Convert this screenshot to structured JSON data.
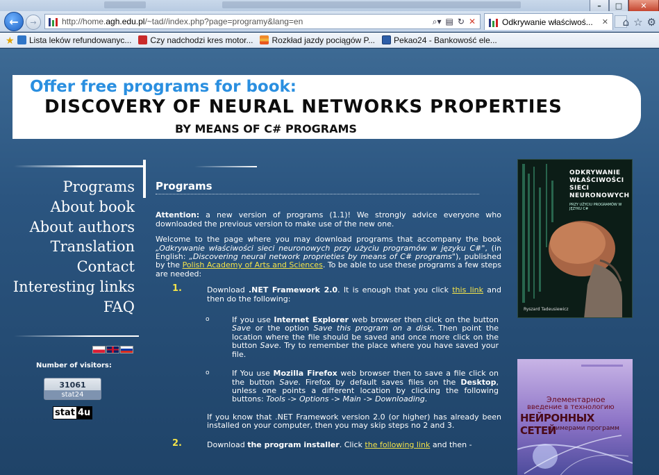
{
  "browser": {
    "address_prefix": "http://home.",
    "address_host": "agh.edu.pl",
    "address_path": "/~tad//index.php?page=programy&lang=en",
    "tab_title": "Odkrywanie właściwoś...",
    "favorites": [
      "Lista leków refundowanyc...",
      "Czy nadchodzi kres motor...",
      "Rozkład jazdy pociągów P...",
      "Pekao24 - Bankowość ele..."
    ]
  },
  "banner": {
    "offer": "Offer free programs for book:",
    "title": "DISCOVERY OF NEURAL NETWORKS PROPERTIES",
    "subtitle": "BY MEANS OF C# PROGRAMS"
  },
  "menu": {
    "items": [
      "Programs",
      "About book",
      "About authors",
      "Translation",
      "Contact",
      "Interesting links",
      "FAQ"
    ]
  },
  "sidebar": {
    "visitors_label": "Number of visitors:",
    "counter_value": "31061",
    "counter_brand": "stat24",
    "stat4u_a": "stat",
    "stat4u_b": "4u"
  },
  "content": {
    "heading": "Programs",
    "attention_label": "Attention:",
    "attention_text": " a new version of programs (1.1)! We strongly advice everyone who downloaded the previous version to make use of the new one.",
    "welcome_1": "Welcome to the page where you may download programs that accompany the book ",
    "welcome_title_pl": "„Odkrywanie właściwości sieci neuronowych przy użyciu programów w języku C#\"",
    "welcome_2": ", (in English: ",
    "welcome_title_en": "„Discovering neural network proprieties by means of C# programs\"",
    "welcome_3": "), published by the ",
    "welcome_link": "Polish Academy of Arts and Sciences",
    "welcome_4": ". To be able to use these programs a few steps are needed:",
    "step1_num": "1.",
    "step1_a": "Download ",
    "step1_bold": ".NET Framework 2.0",
    "step1_b": ". It is enough that you click ",
    "step1_link": "this link",
    "step1_c": " and then do the following:",
    "bullet": "o",
    "ie_a": "If you use ",
    "ie_bold": "Internet Explorer",
    "ie_b": " web browser then click on the button ",
    "ie_save": "Save",
    "ie_c": " or the option ",
    "ie_option": "Save this program on a disk",
    "ie_d": ". Then point the location where the file should be saved and once more click on the button ",
    "ie_save2": "Save",
    "ie_e": ". Try to remember the place where you have saved your file.",
    "ff_a": "If You use ",
    "ff_bold": "Mozilla Firefox",
    "ff_b": " web browser then to save a file click on the button ",
    "ff_save": "Save",
    "ff_c": ". Firefox by default saves files on the ",
    "ff_desktop": "Desktop",
    "ff_d": ", unless one points a different location by clicking the following buttons: ",
    "ff_path": "Tools -> Options -> Main -> Downloading",
    "ff_e": ".",
    "note": "If you know that .NET Framework version 2.0 (or higher) has already been installed on your computer, then you may skip steps no 2 and 3.",
    "step2_num": "2.",
    "step2_a": "Download ",
    "step2_bold": "the program installer",
    "step2_b": ". Click ",
    "step2_link": "the following link",
    "step2_c": " and then -"
  },
  "covers": {
    "pl_title": "ODKRYWANIE WŁAŚCIWOŚCI SIECI NEURONOWYCH",
    "pl_sub": "PRZY UŻYCIU PROGRAMÓW W JĘZYKU C#",
    "pl_author": "Ryszard Tadeusiewicz",
    "ru_line1": "Элементарное",
    "ru_line2": "введение в технологию",
    "ru_line3": "НЕЙРОННЫХ СЕТЕЙ",
    "ru_line4": "с примерами программ"
  },
  "colors": {
    "page_bg": "#2b5580",
    "accent_yellow": "#f3e34a",
    "offer_blue": "#2a8fe0"
  }
}
